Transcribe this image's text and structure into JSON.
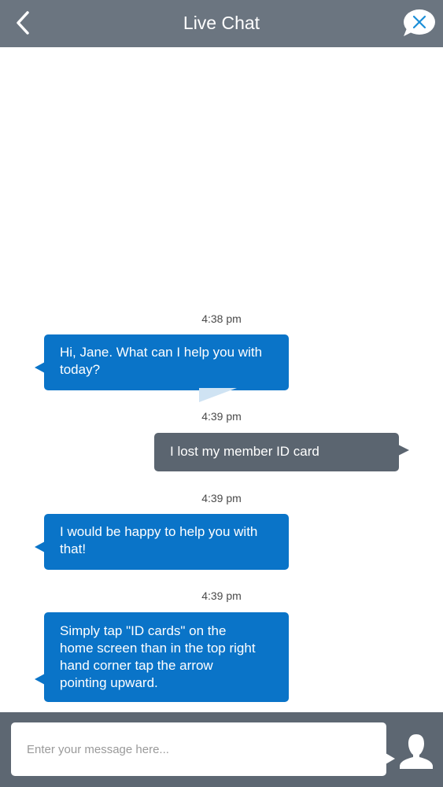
{
  "header": {
    "title": "Live Chat",
    "back_icon": "chevron-left-icon",
    "close_icon": "close-chat-bubble-icon"
  },
  "messages": [
    {
      "timestamp": "4:38 pm",
      "sender": "agent",
      "text_lines": [
        "Hi, Jane. What can I help you with",
        "today?"
      ]
    },
    {
      "timestamp": "4:39 pm",
      "sender": "user",
      "text_lines": [
        "I lost my member ID card"
      ]
    },
    {
      "timestamp": "4:39 pm",
      "sender": "agent",
      "text_lines": [
        "I would be happy to help you with",
        "that!"
      ]
    },
    {
      "timestamp": "4:39 pm",
      "sender": "agent",
      "text_lines": [
        "Simply tap \"ID cards\" on the",
        "home screen than in the top right",
        "hand corner tap the arrow",
        "pointing upward."
      ]
    }
  ],
  "composer": {
    "placeholder": "Enter your message here...",
    "value": "",
    "avatar_icon": "user-avatar-icon"
  },
  "colors": {
    "header_bg": "#6b7580",
    "agent_bubble": "#0a74c8",
    "user_bubble": "#5b6570",
    "footer_bg": "#5d6772"
  }
}
